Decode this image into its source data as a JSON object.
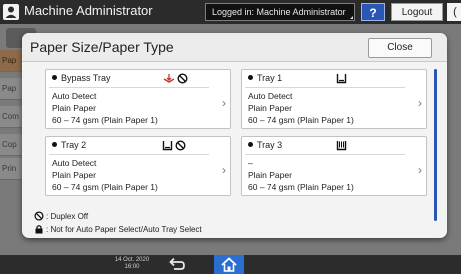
{
  "header": {
    "title": "Machine Administrator",
    "login_status": "Logged in: Machine Administrator",
    "help_label": "?",
    "logout_label": "Logout",
    "edge_label": "("
  },
  "background": {
    "side_items": [
      "Pap",
      "Pap",
      "Com",
      "Cop",
      "Prin"
    ]
  },
  "dialog": {
    "title": "Paper Size/Paper Type",
    "close_label": "Close",
    "trays": [
      {
        "name": "Bypass Tray",
        "icons": [
          "bypass-tray-icon",
          "duplex-off-icon"
        ],
        "lines": [
          "Auto Detect",
          "Plain Paper",
          "60 – 74 gsm (Plain Paper 1)"
        ]
      },
      {
        "name": "Tray 1",
        "icons": [
          "paper-tray-icon"
        ],
        "lines": [
          "Auto Detect",
          "Plain Paper",
          "60 – 74 gsm (Plain Paper 1)"
        ]
      },
      {
        "name": "Tray 2",
        "icons": [
          "paper-tray-icon",
          "duplex-off-icon"
        ],
        "lines": [
          "Auto Detect",
          "Plain Paper",
          "60 – 74 gsm (Plain Paper 1)"
        ]
      },
      {
        "name": "Tray 3",
        "icons": [
          "paper-tray-full-icon"
        ],
        "lines": [
          "–",
          "Plain Paper",
          "60 – 74 gsm (Plain Paper 1)"
        ]
      }
    ],
    "legend": {
      "duplex_off": ": Duplex Off",
      "not_for_auto": ": Not for Auto Paper Select/Auto Tray Select"
    }
  },
  "footer": {
    "date": "14 Oct. 2020",
    "time": "16:00"
  },
  "colors": {
    "accent_blue": "#2a56b5",
    "home_blue": "#2a6fd0",
    "bypass_red": "#c0392b"
  }
}
